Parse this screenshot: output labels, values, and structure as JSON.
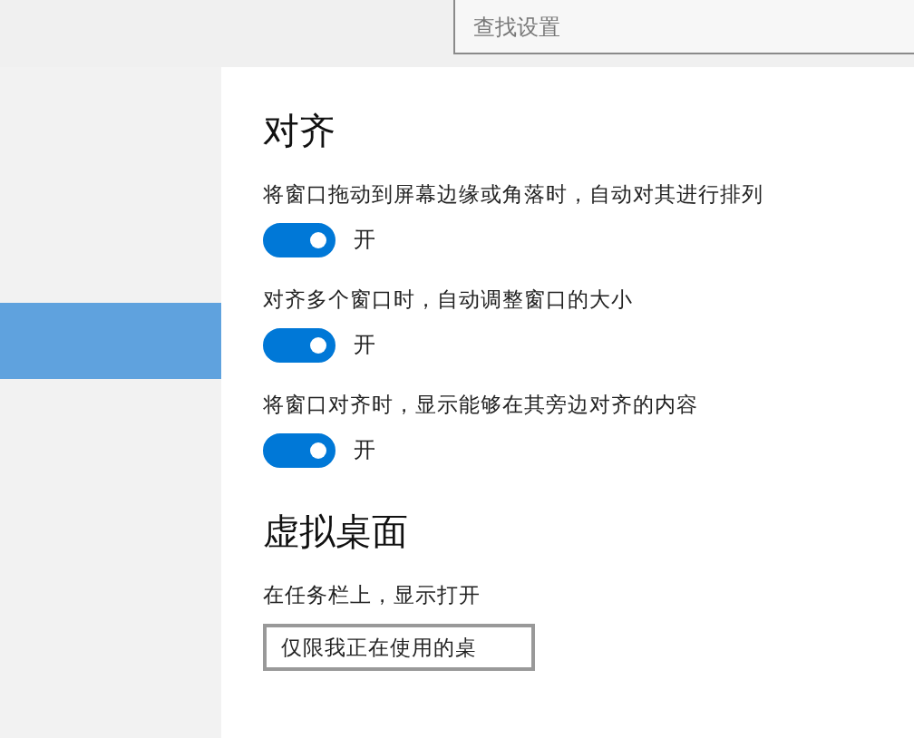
{
  "search": {
    "placeholder": "查找设置"
  },
  "sidebar": {
    "items": [
      {
        "selected": true
      }
    ]
  },
  "sections": [
    {
      "title": "对齐",
      "settings": [
        {
          "kind": "toggle",
          "label": "将窗口拖动到屏幕边缘或角落时，自动对其进行排列",
          "on": true,
          "state_text": "开"
        },
        {
          "kind": "toggle",
          "label": "对齐多个窗口时，自动调整窗口的大小",
          "on": true,
          "state_text": "开"
        },
        {
          "kind": "toggle",
          "label": "将窗口对齐时，显示能够在其旁边对齐的内容",
          "on": true,
          "state_text": "开"
        }
      ]
    },
    {
      "title": "虚拟桌面",
      "settings": [
        {
          "kind": "dropdown",
          "label": "在任务栏上，显示打开",
          "value": "仅限我正在使用的桌"
        }
      ]
    }
  ]
}
